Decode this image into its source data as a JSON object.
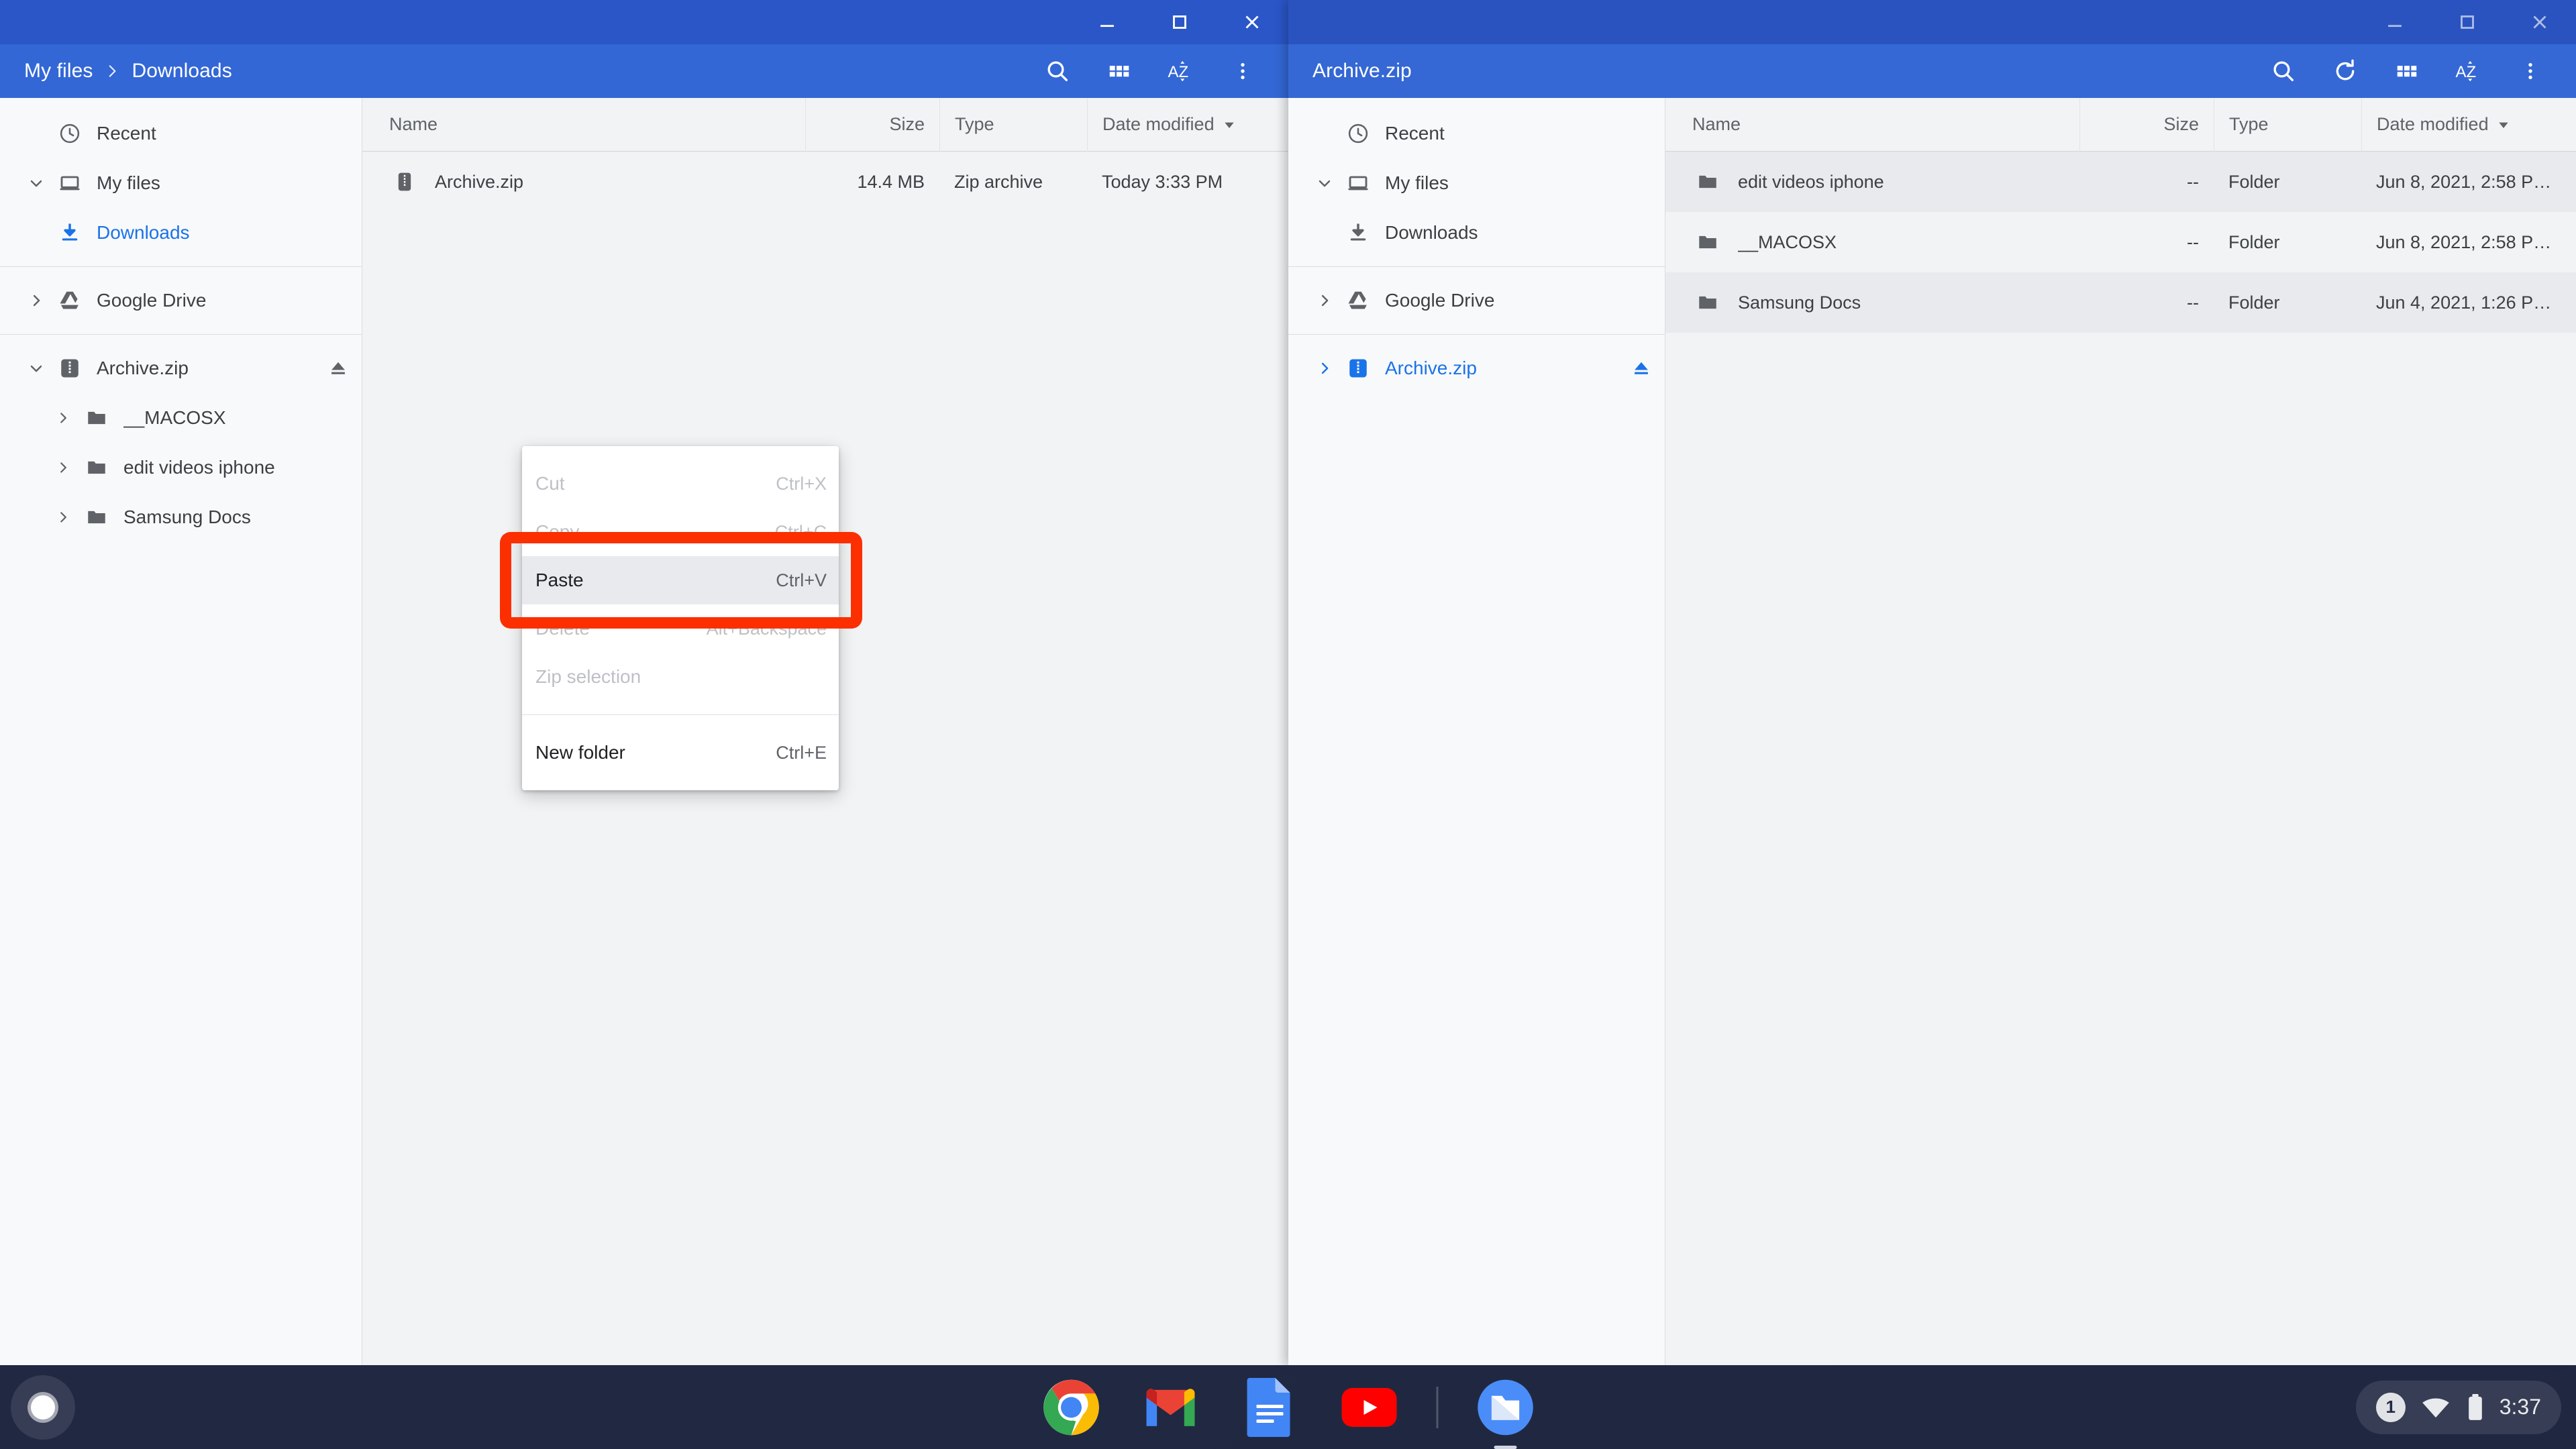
{
  "colors": {
    "titlebar": "#2a56c8",
    "toolbar": "#3367d6",
    "accent": "#1a73e8",
    "annotation": "#fc2f00",
    "row_alt": "#e8eaed",
    "sidebar_bg": "#f8f9fa"
  },
  "left_window": {
    "window_controls": {
      "minimize": "minimize-icon",
      "maximize": "maximize-icon",
      "close": "close-icon"
    },
    "breadcrumb": {
      "root": "My files",
      "separator": "›",
      "current": "Downloads"
    },
    "toolbar_actions": [
      {
        "name": "search-icon",
        "label": "Search"
      },
      {
        "name": "grid-view-icon",
        "label": "Switch to grid view"
      },
      {
        "name": "sort-az-icon",
        "label": "Sort"
      },
      {
        "name": "more-vert-icon",
        "label": "More options"
      }
    ],
    "sidebar": [
      {
        "label": "Recent",
        "icon": "clock-icon",
        "twisty": "none",
        "indent": 0,
        "selected": false
      },
      {
        "label": "My files",
        "icon": "laptop-icon",
        "twisty": "expanded",
        "indent": 0,
        "selected": false
      },
      {
        "label": "Downloads",
        "icon": "download-icon",
        "twisty": "none",
        "indent": 1,
        "selected": true
      },
      {
        "label": "Google Drive",
        "icon": "google-drive-icon",
        "twisty": "collapsed",
        "indent": 0,
        "selected": false
      },
      {
        "label": "Archive.zip",
        "icon": "zip-icon",
        "twisty": "expanded",
        "indent": 0,
        "selected": false,
        "eject": true
      },
      {
        "label": "__MACOSX",
        "icon": "folder-icon",
        "twisty": "collapsed",
        "indent": 2,
        "selected": false
      },
      {
        "label": "edit videos iphone",
        "icon": "folder-icon",
        "twisty": "collapsed",
        "indent": 2,
        "selected": false
      },
      {
        "label": "Samsung Docs",
        "icon": "folder-icon",
        "twisty": "collapsed",
        "indent": 2,
        "selected": false
      }
    ],
    "columns": {
      "name": "Name",
      "size": "Size",
      "type": "Type",
      "date": "Date modified"
    },
    "sort": {
      "column": "Date modified",
      "direction": "descending"
    },
    "rows": [
      {
        "icon": "zip-icon",
        "name": "Archive.zip",
        "size": "14.4 MB",
        "type": "Zip archive",
        "date": "Today 3:33 PM"
      }
    ]
  },
  "right_window": {
    "window_controls": {
      "minimize": "minimize-icon",
      "maximize": "maximize-icon",
      "close": "close-icon"
    },
    "breadcrumb": {
      "current": "Archive.zip"
    },
    "toolbar_actions": [
      {
        "name": "search-icon",
        "label": "Search"
      },
      {
        "name": "refresh-icon",
        "label": "Refresh"
      },
      {
        "name": "grid-view-icon",
        "label": "Switch to grid view"
      },
      {
        "name": "sort-az-icon",
        "label": "Sort"
      },
      {
        "name": "more-vert-icon",
        "label": "More options"
      }
    ],
    "sidebar": [
      {
        "label": "Recent",
        "icon": "clock-icon",
        "twisty": "none",
        "indent": 0,
        "selected": false
      },
      {
        "label": "My files",
        "icon": "laptop-icon",
        "twisty": "expanded",
        "indent": 0,
        "selected": false
      },
      {
        "label": "Downloads",
        "icon": "download-icon",
        "twisty": "none",
        "indent": 1,
        "selected": false
      },
      {
        "label": "Google Drive",
        "icon": "google-drive-icon",
        "twisty": "collapsed",
        "indent": 0,
        "selected": false
      },
      {
        "label": "Archive.zip",
        "icon": "zip-icon-blue",
        "twisty": "collapsed",
        "indent": 0,
        "selected": true,
        "eject": true
      }
    ],
    "columns": {
      "name": "Name",
      "size": "Size",
      "type": "Type",
      "date": "Date modified"
    },
    "sort": {
      "column": "Date modified",
      "direction": "descending"
    },
    "rows": [
      {
        "icon": "folder-icon",
        "name": "edit videos iphone",
        "size": "--",
        "type": "Folder",
        "date": "Jun 8, 2021, 2:58 P…"
      },
      {
        "icon": "folder-icon",
        "name": "__MACOSX",
        "size": "--",
        "type": "Folder",
        "date": "Jun 8, 2021, 2:58 P…"
      },
      {
        "icon": "folder-icon",
        "name": "Samsung Docs",
        "size": "--",
        "type": "Folder",
        "date": "Jun 4, 2021, 1:26 P…"
      }
    ]
  },
  "context_menu": {
    "items": [
      {
        "label": "Cut",
        "shortcut": "Ctrl+X",
        "disabled": true,
        "active": false
      },
      {
        "label": "Copy",
        "shortcut": "Ctrl+C",
        "disabled": true,
        "active": false
      },
      {
        "label": "Paste",
        "shortcut": "Ctrl+V",
        "disabled": false,
        "active": true
      },
      {
        "label": "Delete",
        "shortcut": "Alt+Backspace",
        "disabled": true,
        "active": false
      },
      {
        "label": "Zip selection",
        "shortcut": "",
        "disabled": true,
        "active": false
      }
    ],
    "items_after_separator": [
      {
        "label": "New folder",
        "shortcut": "Ctrl+E",
        "disabled": false,
        "active": false
      }
    ]
  },
  "annotation": {
    "target": "Paste",
    "color": "#fc2f00"
  },
  "shelf": {
    "launcher": "launcher-button",
    "apps": [
      {
        "name": "chrome-icon",
        "label": "Google Chrome",
        "active": false
      },
      {
        "name": "gmail-icon",
        "label": "Gmail",
        "active": false
      },
      {
        "name": "google-docs-icon",
        "label": "Google Docs",
        "active": false
      },
      {
        "name": "youtube-icon",
        "label": "YouTube",
        "active": false
      },
      {
        "name": "files-icon",
        "label": "Files",
        "active": true
      }
    ],
    "tray": {
      "notification_count": "1",
      "wifi": "wifi-icon",
      "battery": "battery-icon",
      "clock": "3:37"
    }
  }
}
